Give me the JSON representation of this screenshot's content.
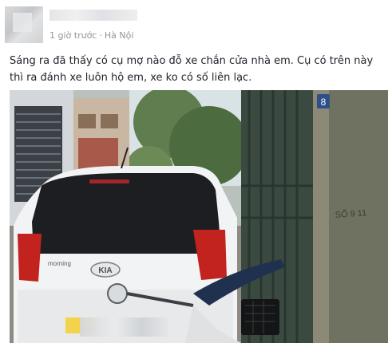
{
  "post": {
    "meta": {
      "time": "1 giờ trước",
      "separator": "·",
      "location": "Hà Nội"
    },
    "text": "Sáng ra đã thấy có cụ mợ nào đỗ xe chắn cửa nhà em. Cụ có trên này thì ra đánh xe luôn hộ em, xe ko có số liên lạc.",
    "photo": {
      "car_brand_badge": "KIA",
      "car_model_label": "morning",
      "house_number": "8",
      "wall_text": "SỐ 9 11"
    }
  }
}
